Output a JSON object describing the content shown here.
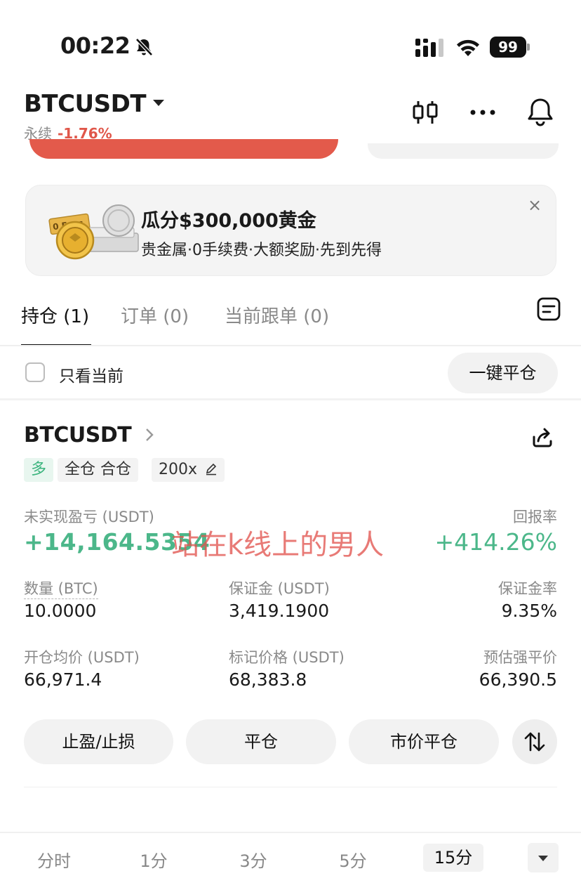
{
  "status_bar": {
    "time": "00:22",
    "battery": "99",
    "icons": [
      "bell-off-icon",
      "cellular-icon",
      "wifi-icon",
      "battery-icon"
    ]
  },
  "header": {
    "symbol": "BTCUSDT",
    "contract_type": "永续",
    "change": "-1.76%",
    "icons": [
      "candlestick-icon",
      "more-icon",
      "bell-icon"
    ]
  },
  "colors": {
    "up": "#4cb78a",
    "down": "#e0574a",
    "watermark": "#e15550"
  },
  "banner": {
    "title": "瓜分$300,000黄金",
    "subtitle": "贵金属·0手续费·大额奖励·先到先得",
    "art_label": "0 Fees"
  },
  "tabs": [
    {
      "label": "持仓 (1)",
      "active": true
    },
    {
      "label": "订单 (0)",
      "active": false
    },
    {
      "label": "当前跟单 (0)",
      "active": false
    }
  ],
  "filter": {
    "only_current_label": "只看当前",
    "only_current_checked": false,
    "close_all_label": "一键平仓"
  },
  "position": {
    "symbol": "BTCUSDT",
    "side": "多",
    "margin_mode": "全仓 合仓",
    "leverage": "200x",
    "pnl_label": "未实现盈亏 (USDT)",
    "pnl_value": "+14,164.5354",
    "roe_label": "回报率",
    "roe_value": "+414.26%",
    "watermark": "站在k线上的男人",
    "qty_label": "数量 (BTC)",
    "qty_value": "10.0000",
    "margin_label": "保证金 (USDT)",
    "margin_value": "3,419.1900",
    "margin_ratio_label": "保证金率",
    "margin_ratio_value": "9.35%",
    "entry_label": "开仓均价 (USDT)",
    "entry_value": "66,971.4",
    "mark_label": "标记价格 (USDT)",
    "mark_value": "68,383.8",
    "liq_label": "预估强平价",
    "liq_value": "66,390.5",
    "actions": {
      "tpsl": "止盈/止损",
      "close": "平仓",
      "market_close": "市价平仓"
    }
  },
  "timeframes": [
    {
      "label": "分时",
      "active": false
    },
    {
      "label": "1分",
      "active": false
    },
    {
      "label": "3分",
      "active": false
    },
    {
      "label": "5分",
      "active": false
    },
    {
      "label": "15分",
      "active": true
    }
  ]
}
